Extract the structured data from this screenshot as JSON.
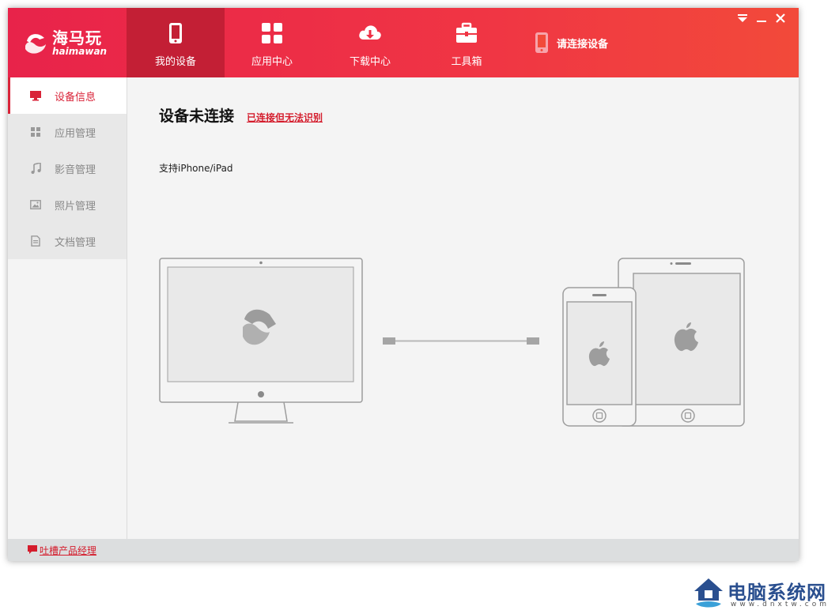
{
  "app": {
    "logo_text": "海马玩",
    "logo_sub": "haimawan"
  },
  "nav": {
    "tabs": [
      {
        "label": "我的设备",
        "icon": "phone-icon",
        "active": true
      },
      {
        "label": "应用中心",
        "icon": "apps-grid-icon",
        "active": false
      },
      {
        "label": "下载中心",
        "icon": "cloud-download-icon",
        "active": false
      },
      {
        "label": "工具箱",
        "icon": "toolbox-icon",
        "active": false
      }
    ],
    "device_status": "请连接设备"
  },
  "window_controls": [
    "menu-icon",
    "minimize-icon",
    "close-icon"
  ],
  "sidebar": {
    "items": [
      {
        "label": "设备信息",
        "icon": "monitor-icon",
        "active": true
      },
      {
        "label": "应用管理",
        "icon": "grid-icon",
        "active": false
      },
      {
        "label": "影音管理",
        "icon": "music-note-icon",
        "active": false
      },
      {
        "label": "照片管理",
        "icon": "picture-icon",
        "active": false
      },
      {
        "label": "文档管理",
        "icon": "document-icon",
        "active": false
      }
    ]
  },
  "main": {
    "title": "设备未连接",
    "link": "已连接但无法识别",
    "support_text": "支持iPhone/iPad"
  },
  "footer": {
    "feedback_link": "吐槽产品经理"
  },
  "watermark": {
    "title": "电脑系统网",
    "url": "www.dnxtw.com"
  },
  "colors": {
    "brand": "#e8234a",
    "active_tab": "#c31f35",
    "accent_text": "#d41c2c"
  }
}
